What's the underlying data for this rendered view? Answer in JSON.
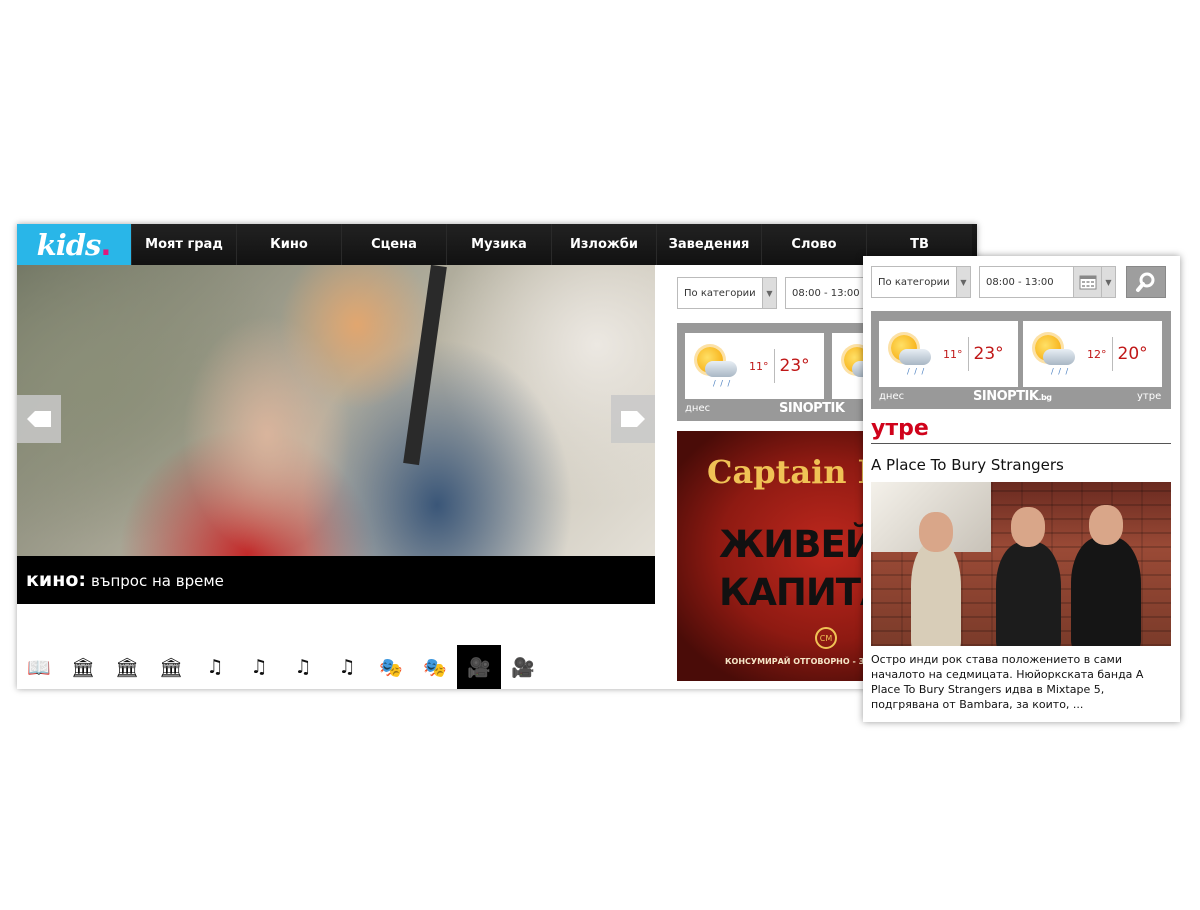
{
  "site": {
    "logo": "kids",
    "nav": [
      "Моят град",
      "Кино",
      "Сцена",
      "Музика",
      "Изложби",
      "Заведения",
      "Слово",
      "ТВ"
    ]
  },
  "hero": {
    "category": "кино:",
    "title": "въпрос на време",
    "prev_icon": "arrow-left-icon",
    "next_icon": "arrow-right-icon"
  },
  "category_icons": [
    {
      "name": "book-icon",
      "glyph": "📖",
      "active": false
    },
    {
      "name": "museum-icon",
      "glyph": "🏛",
      "active": false
    },
    {
      "name": "museum-icon",
      "glyph": "🏛",
      "active": false
    },
    {
      "name": "museum-icon",
      "glyph": "🏛",
      "active": false
    },
    {
      "name": "music-note-icon",
      "glyph": "♫",
      "active": false
    },
    {
      "name": "music-note-icon",
      "glyph": "♫",
      "active": false
    },
    {
      "name": "music-note-icon",
      "glyph": "♫",
      "active": false
    },
    {
      "name": "music-note-icon",
      "glyph": "♫",
      "active": false
    },
    {
      "name": "theater-masks-icon",
      "glyph": "🎭",
      "active": false
    },
    {
      "name": "theater-masks-icon",
      "glyph": "🎭",
      "active": false
    },
    {
      "name": "movie-camera-icon",
      "glyph": "🎥",
      "active": true
    },
    {
      "name": "movie-camera-icon",
      "glyph": "🎥",
      "active": false
    }
  ],
  "filters": {
    "category_select": "По категории",
    "time_select": "08:00 - 13:00"
  },
  "weather": {
    "today": {
      "label": "днес",
      "min": "11°",
      "max": "23°"
    },
    "tomorrow": {
      "label": "утре",
      "min": "12°",
      "max": "20°"
    },
    "provider": "SINOPTIK",
    "provider_suffix": ".bg"
  },
  "ad": {
    "brand": "Captain Mo",
    "line1": "ЖИВЕЙ К",
    "line2": "КАПИТА",
    "emblem": "CM",
    "footer": "КОНСУМИРАЙ ОТГОВОРНО - ЗАПОВ"
  },
  "panel": {
    "heading": "утре",
    "event_title": "A Place To Bury Strangers",
    "description": "Остро инди рок става положението в сами началото на седмицата. Нюйоркската банда A Place To Bury Strangers идва в Mixtape 5, подгрявана от Bambara, за които, ..."
  },
  "colors": {
    "logo_bg": "#29b6e8",
    "accent_red": "#d0021b",
    "navbar": "#111111"
  }
}
